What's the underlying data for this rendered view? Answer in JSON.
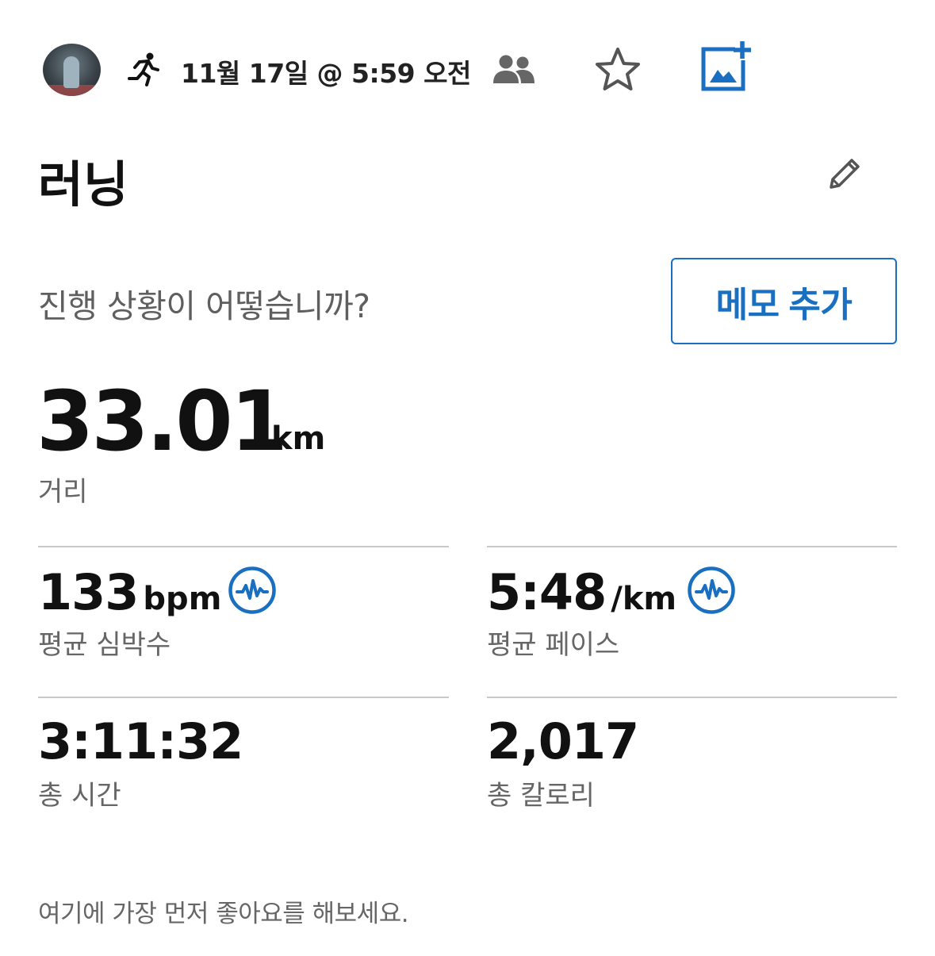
{
  "header": {
    "avatar": "user-avatar",
    "activity_icon": "running-icon",
    "datetime": "11월 17일 @ 5:59 오전",
    "privacy_icon": "people-icon",
    "favorite_icon": "star-icon",
    "add_photo_icon": "add-photo-icon"
  },
  "activity": {
    "title": "러닝",
    "edit_icon": "pencil-icon"
  },
  "note": {
    "prompt": "진행 상황이 어떻습니까?",
    "button_label": "메모 추가"
  },
  "distance": {
    "value": "33.01",
    "unit": "km",
    "label": "거리"
  },
  "stats": {
    "heart_rate": {
      "value": "133",
      "unit": "bpm",
      "label": "평균 심박수",
      "icon": "heart-rate-chart-icon"
    },
    "pace": {
      "value": "5:48",
      "unit": "/km",
      "label": "평균 페이스",
      "icon": "pace-chart-icon"
    },
    "total_time": {
      "value": "3:11:32",
      "label": "총 시간"
    },
    "calories": {
      "value": "2,017",
      "label": "총 칼로리"
    }
  },
  "footer": {
    "like_prompt": "여기에 가장 먼저 좋아요를 해보세요."
  },
  "colors": {
    "accent": "#1a6fc0",
    "text_primary": "#111111",
    "text_secondary": "#666666",
    "divider": "#c8c8c8"
  }
}
